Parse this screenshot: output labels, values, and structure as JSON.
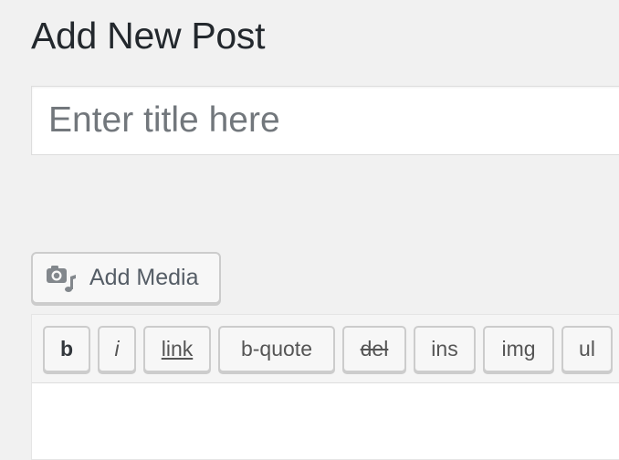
{
  "page": {
    "title": "Add New Post"
  },
  "title_field": {
    "placeholder": "Enter title here",
    "value": ""
  },
  "media": {
    "add_media_label": "Add Media",
    "icon": "media-camera-music-icon"
  },
  "quicktags": {
    "buttons": [
      {
        "id": "bold",
        "label": "b"
      },
      {
        "id": "italic",
        "label": "i"
      },
      {
        "id": "link",
        "label": "link"
      },
      {
        "id": "blockquote",
        "label": "b-quote"
      },
      {
        "id": "del",
        "label": "del"
      },
      {
        "id": "ins",
        "label": "ins"
      },
      {
        "id": "img",
        "label": "img"
      },
      {
        "id": "ul",
        "label": "ul"
      }
    ]
  },
  "editor": {
    "content": ""
  },
  "colors": {
    "background": "#f1f1f1",
    "text": "#23282d",
    "button_border": "#cccccc",
    "placeholder": "#72777c"
  }
}
